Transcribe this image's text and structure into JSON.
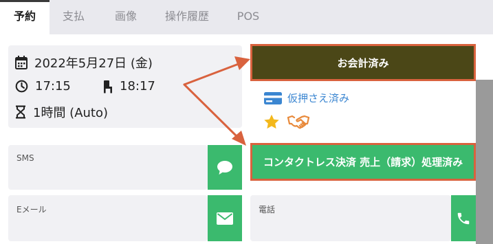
{
  "tabs": [
    {
      "label": "予約",
      "active": true
    },
    {
      "label": "支払",
      "active": false
    },
    {
      "label": "画像",
      "active": false
    },
    {
      "label": "操作履歴",
      "active": false
    },
    {
      "label": "POS",
      "active": false
    }
  ],
  "booking": {
    "date": "2022年5月27日 (金)",
    "start_time": "17:15",
    "seat_time": "18:17",
    "duration": "1時間 (Auto)"
  },
  "payment": {
    "paid_label": "お会計済み",
    "hold_status": "仮押さえ済み",
    "contactless_label": "コンタクトレス決済 売上（請求）処理済み"
  },
  "contact": {
    "sms_label": "SMS",
    "email_label": "Eメール",
    "phone_label": "電話"
  },
  "colors": {
    "paid_bg": "#4b4717",
    "contactless_bg": "#3bba6e",
    "highlight_border": "#d9623e",
    "link_blue": "#3b86d1",
    "star": "#f3b81c",
    "handshake": "#e8893a"
  },
  "icons": {
    "date": "calendar-icon",
    "start_time": "clock-icon",
    "seat_time": "chair-icon",
    "duration": "hourglass-icon",
    "hold": "credit-card-icon",
    "vip": "star-icon",
    "partner": "handshake-icon",
    "sms": "chat-bubble-icon",
    "email": "envelope-icon",
    "phone": "phone-icon"
  }
}
